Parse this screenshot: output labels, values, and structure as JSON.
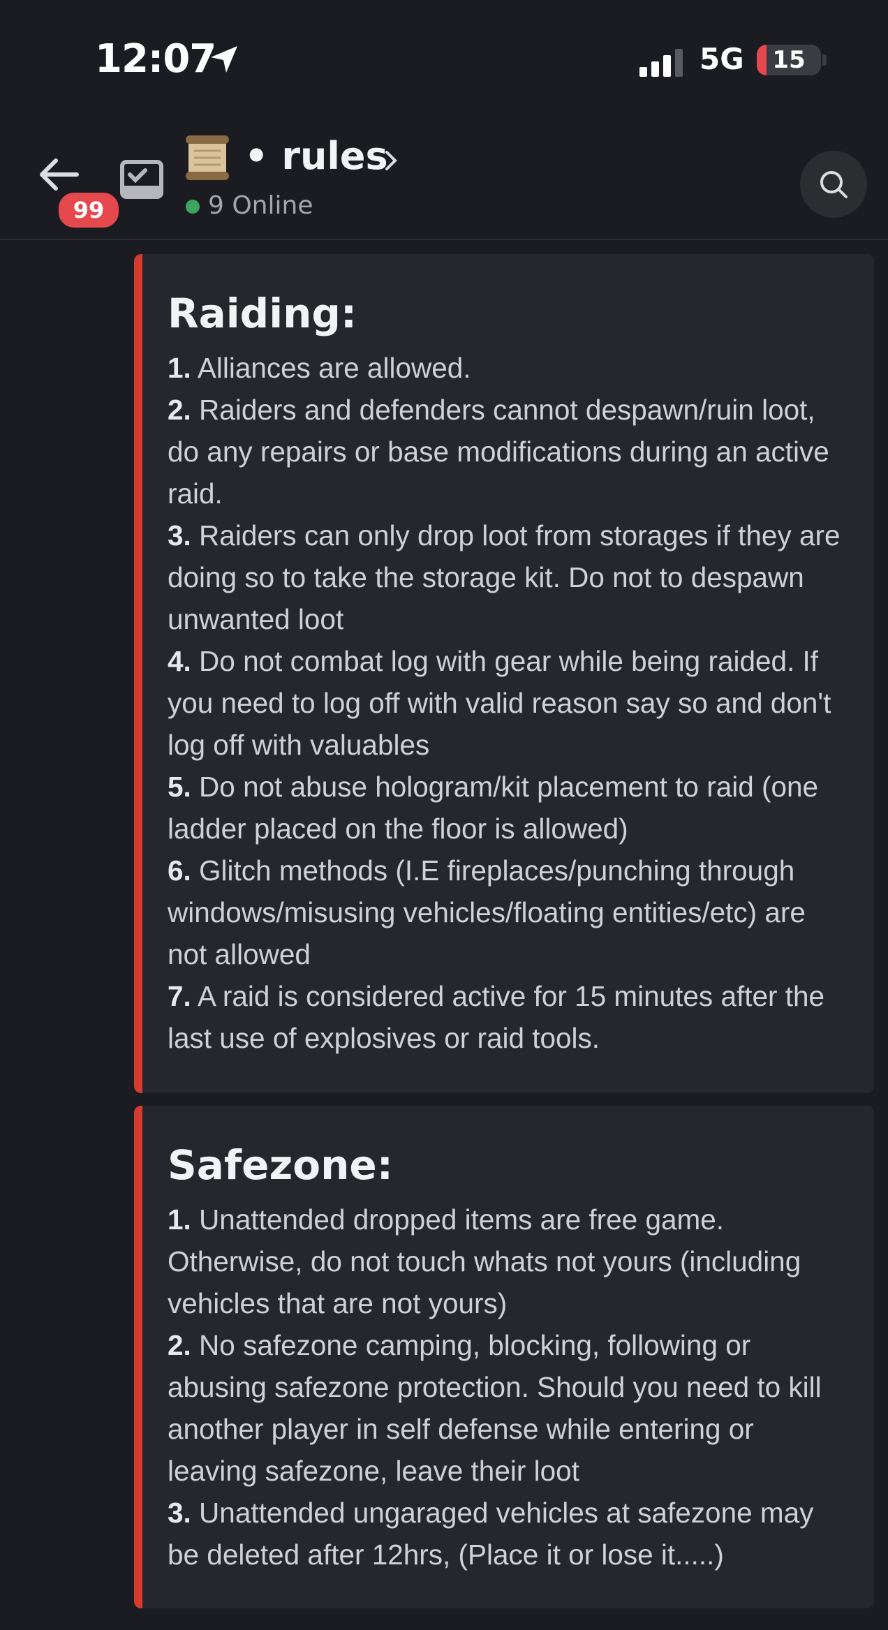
{
  "status_bar": {
    "time": "12:07",
    "network": "5G",
    "battery": "15",
    "battery_level_percent": 15,
    "battery_color": "#e5484d"
  },
  "header": {
    "mention_count": "99",
    "channel_emoji": "scroll-emoji",
    "channel_prefix": "•",
    "channel_name": "rules",
    "online": "9 Online",
    "online_color": "#3ba55d"
  },
  "embeds": [
    {
      "title": "Raiding:",
      "accent_color": "#d73a2f",
      "rules": [
        {
          "num": "1.",
          "text": "Alliances are allowed."
        },
        {
          "num": "2.",
          "text": "Raiders and defenders cannot despawn/ruin loot, do any repairs or base modifications during an active raid."
        },
        {
          "num": "3.",
          "text": "Raiders can only drop loot from storages if they are doing so to take the storage kit. Do not to despawn unwanted loot"
        },
        {
          "num": "4.",
          "text": "Do not combat log with gear while being raided. If you need to log off with valid reason say so and don't log off with valuables"
        },
        {
          "num": "5.",
          "text": "Do not abuse hologram/kit placement to raid (one ladder placed on the floor is allowed)"
        },
        {
          "num": "6.",
          "text": "Glitch methods (I.E fireplaces/punching through windows/misusing vehicles/floating entities/etc) are not allowed"
        },
        {
          "num": "7.",
          "text": "A raid is considered active for 15 minutes after the last use of explosives or raid tools."
        }
      ]
    },
    {
      "title": "Safezone:",
      "accent_color": "#d73a2f",
      "rules": [
        {
          "num": "1.",
          "text": "Unattended dropped items are free game. Otherwise, do not touch whats not yours (including vehicles that are not yours)"
        },
        {
          "num": "2.",
          "text": "No safezone camping, blocking, following or abusing safezone protection. Should you need to kill another player in self defense while entering or leaving safezone, leave their loot"
        },
        {
          "num": "3.",
          "text": "Unattended ungaraged vehicles at safezone may be deleted after 12hrs, (Place it or lose it.....)"
        }
      ]
    }
  ]
}
